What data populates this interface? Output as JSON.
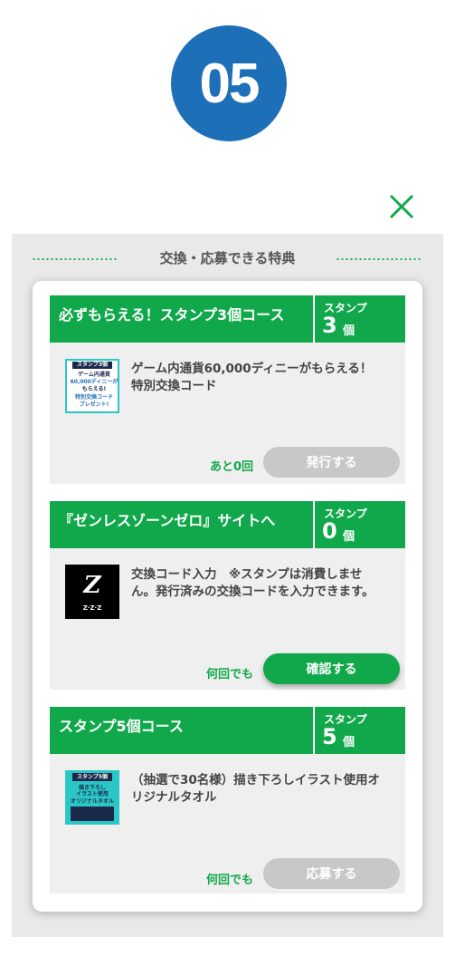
{
  "step": {
    "number": "05",
    "color": "#1d6fb8"
  },
  "close": {
    "icon": "close-icon",
    "color": "#10a84a"
  },
  "panel": {
    "title": "交換・応募できる特典"
  },
  "colors": {
    "accent": "#10a84a",
    "disabled": "#c8c8c8"
  },
  "items": [
    {
      "title": "必ずもらえる！スタンプ3個コース",
      "stamp_label": "スタンプ",
      "stamp_count": "3",
      "stamp_unit": "個",
      "thumb": {
        "cap1": "スタンプ3個",
        "cap2": "ゲーム内通貨",
        "cap3": "60,000ディニーが",
        "cap4": "もらえる!",
        "cap5": "特別交換コード",
        "cap6": "プレゼント!"
      },
      "desc": "ゲーム内通貨60,000ディニーがもらえる！特別交換コード",
      "count": "あと0回",
      "button": "発行する",
      "enabled": false
    },
    {
      "title": "『ゼンレスゾーンゼロ』サイトへ",
      "stamp_label": "スタンプ",
      "stamp_count": "0",
      "stamp_unit": "個",
      "thumb": {
        "logo": "Z",
        "sub": "Z·Z·Z"
      },
      "desc": "交換コード入力　※スタンプは消費しません。発行済みの交換コードを入力できます。",
      "count": "何回でも",
      "button": "確認する",
      "enabled": true
    },
    {
      "title": "スタンプ5個コース",
      "stamp_label": "スタンプ",
      "stamp_count": "5",
      "stamp_unit": "個",
      "thumb": {
        "cap1": "スタンプ5個",
        "cap2": "描き下ろし",
        "cap3": "イラスト使用",
        "cap4": "オリジナルタオル"
      },
      "desc": "（抽選で30名様）描き下ろしイラスト使用オリジナルタオル",
      "count": "何回でも",
      "button": "応募する",
      "enabled": false
    }
  ]
}
